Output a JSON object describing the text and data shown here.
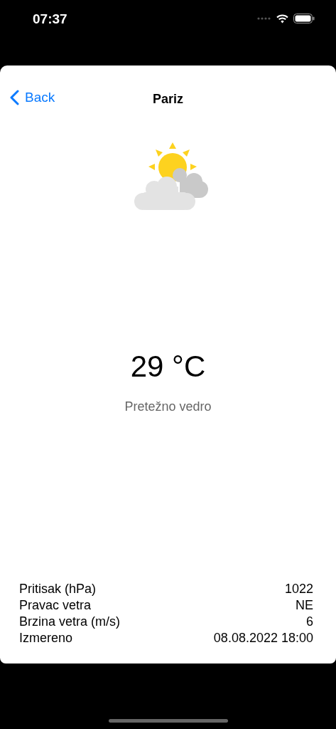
{
  "status_bar": {
    "time": "07:37"
  },
  "nav": {
    "back": "Back",
    "title": "Pariz"
  },
  "weather": {
    "temperature": "29 °C",
    "description": "Pretežno vedro"
  },
  "details": [
    {
      "label": "Pritisak (hPa)",
      "value": "1022"
    },
    {
      "label": "Pravac vetra",
      "value": "NE"
    },
    {
      "label": "Brzina vetra (m/s)",
      "value": "6"
    },
    {
      "label": "Izmereno",
      "value": "08.08.2022 18:00"
    }
  ]
}
